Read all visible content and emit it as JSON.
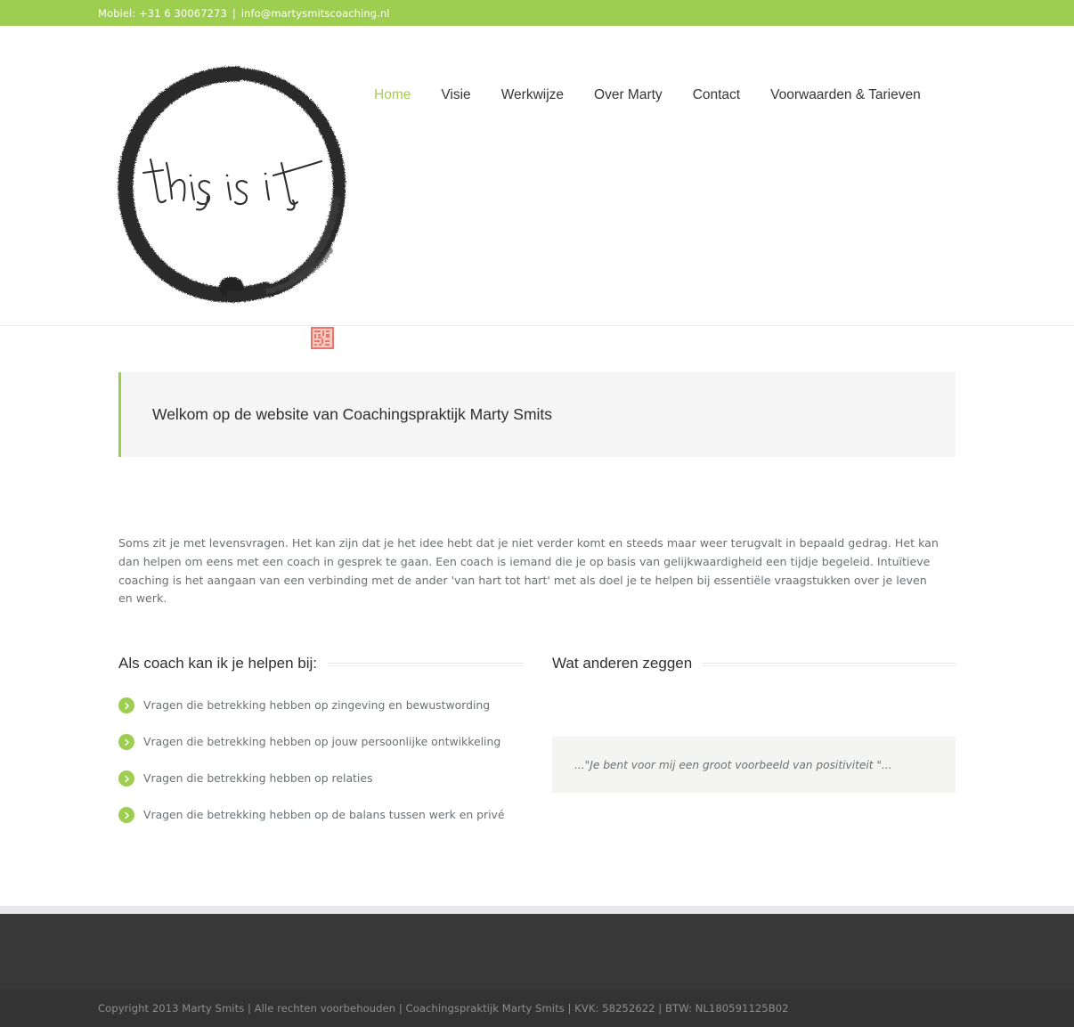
{
  "topbar": {
    "phone_label": "Mobiel: +31 6 30067273",
    "separator": "|",
    "email": "info@martysmitscoaching.nl"
  },
  "logo": {
    "script_text": "this is it",
    "alt": "Enso circle logo with handwritten text",
    "seal_name": "red-seal-stamp"
  },
  "nav": {
    "items": [
      {
        "label": "Home",
        "active": true
      },
      {
        "label": "Visie",
        "active": false
      },
      {
        "label": "Werkwijze",
        "active": false
      },
      {
        "label": "Over Marty",
        "active": false
      },
      {
        "label": "Contact",
        "active": false
      },
      {
        "label": "Voorwaarden & Tarieven",
        "active": false
      }
    ]
  },
  "main": {
    "welcome_title": "Welkom op de website van Coachingspraktijk Marty Smits",
    "intro_paragraph": "Soms zit je met levensvragen. Het kan zijn dat je het idee hebt dat je niet verder komt en steeds maar weer terugvalt in bepaald gedrag. Het kan dan helpen om eens met een coach in gesprek te gaan. Een coach is iemand die je op basis van gelijkwaardigheid een tijdje begeleid. Intuïtieve coaching is het aangaan van een verbinding met de ander 'van hart tot hart' met als doel je te helpen bij essentiële vraagstukken over je leven en werk."
  },
  "coach_section": {
    "heading": "Als coach kan ik je helpen bij:",
    "items": [
      "Vragen die betrekking hebben op zingeving en bewustwording",
      "Vragen die betrekking hebben op jouw persoonlijke ontwikkeling",
      "Vragen die betrekking hebben op relaties",
      "Vragen die betrekking hebben op de balans tussen werk en privé"
    ]
  },
  "testimonial_section": {
    "heading": "Wat anderen zeggen",
    "quote": "...\"Je bent voor mij een groot voorbeeld van positiviteit \"..."
  },
  "footer": {
    "copyright": "Copyright 2013 Marty Smits | Alle rechten voorbehouden | Coachingspraktijk Marty Smits | KVK: 58252622 | BTW: NL180591125B02"
  },
  "colors": {
    "accent_green": "#9ECE4F",
    "nav_active_green": "#A6CE4E",
    "box_background": "#F5F5F5",
    "quote_background": "#F4F4F2",
    "footer_dark": "#383838",
    "footer_bottom": "#333333",
    "body_text": "#6b7073",
    "seal_red": "#E8766B"
  }
}
